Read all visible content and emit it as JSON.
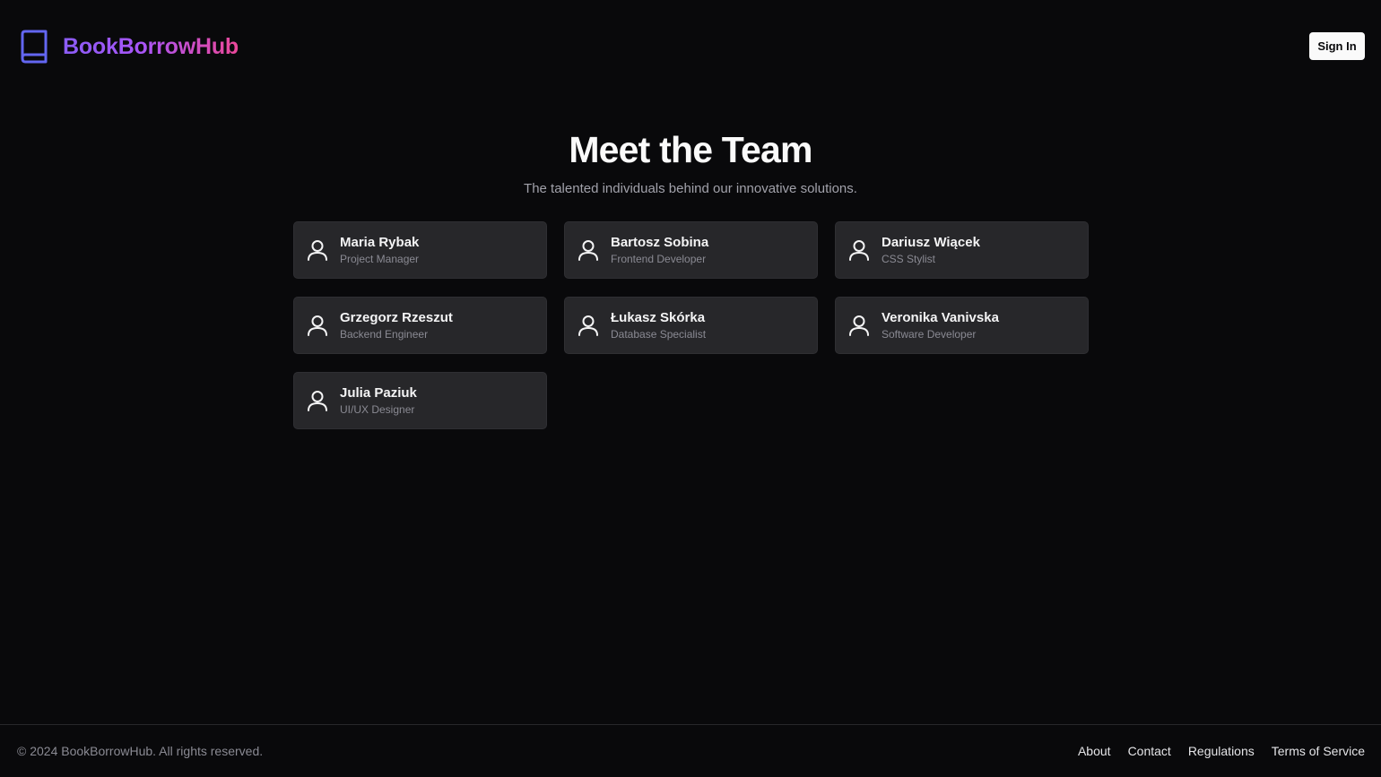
{
  "header": {
    "brand_name": "BookBorrowHub",
    "brand_icon": "book-icon",
    "signin_label": "Sign In"
  },
  "hero": {
    "title": "Meet the Team",
    "subtitle": "The talented individuals behind our innovative solutions."
  },
  "team": [
    {
      "name": "Maria Rybak",
      "role": "Project Manager",
      "icon": "user-icon"
    },
    {
      "name": "Bartosz Sobina",
      "role": "Frontend Developer",
      "icon": "user-icon"
    },
    {
      "name": "Dariusz Wiącek",
      "role": "CSS Stylist",
      "icon": "user-icon"
    },
    {
      "name": "Grzegorz Rzeszut",
      "role": "Backend Engineer",
      "icon": "user-icon"
    },
    {
      "name": "Łukasz Skórka",
      "role": "Database Specialist",
      "icon": "user-icon"
    },
    {
      "name": "Veronika Vanivska",
      "role": "Software Developer",
      "icon": "user-icon"
    },
    {
      "name": "Julia Paziuk",
      "role": "UI/UX Designer",
      "icon": "user-icon"
    }
  ],
  "footer": {
    "copyright": "© 2024 BookBorrowHub. All rights reserved.",
    "links": [
      "About",
      "Contact",
      "Regulations",
      "Terms of Service"
    ]
  },
  "colors": {
    "background": "#09090b",
    "card": "#27272a",
    "brand_icon": "#6366f1",
    "brand_gradient_start": "#8b5cf6",
    "brand_gradient_end": "#ec4899",
    "muted_text": "#a1a1aa"
  }
}
